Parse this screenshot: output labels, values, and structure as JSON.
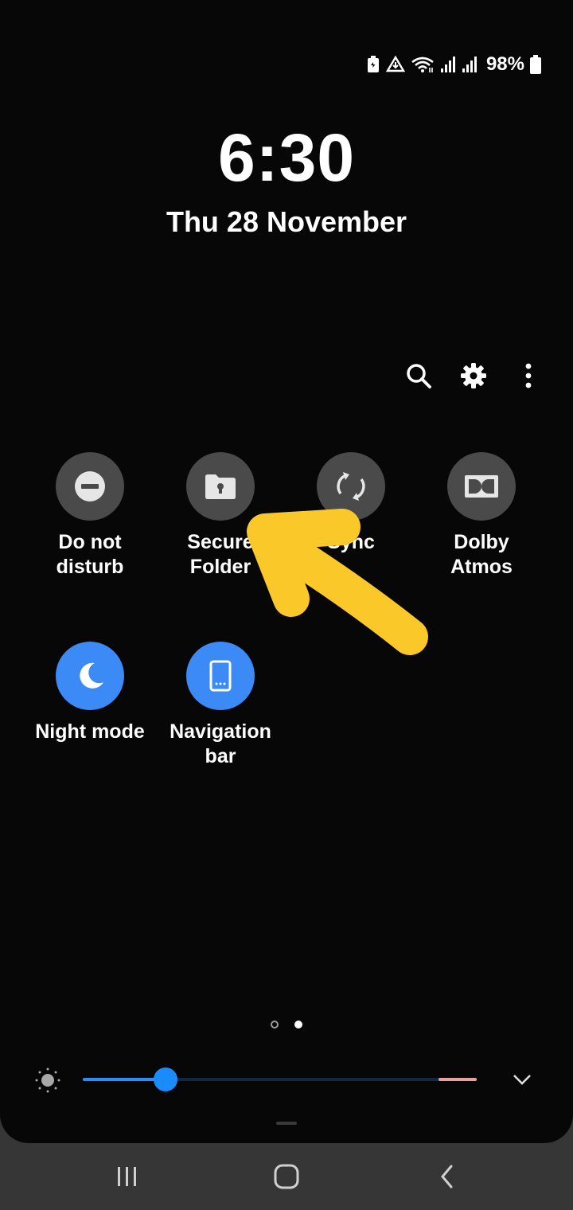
{
  "status_bar": {
    "battery_percent": "98%",
    "icons": [
      "battery-saver-icon",
      "data-saver-icon",
      "wifi-icon",
      "signal-icon",
      "signal-icon",
      "battery-icon"
    ]
  },
  "lock": {
    "time": "6:30",
    "date": "Thu 28 November"
  },
  "header_actions": [
    "search-icon",
    "gear-icon",
    "more-vert-icon"
  ],
  "tiles": [
    {
      "label": "Do not\ndisturb",
      "icon": "do-not-disturb-icon",
      "active": false
    },
    {
      "label": "Secure\nFolder",
      "icon": "secure-folder-icon",
      "active": false
    },
    {
      "label": "Sync",
      "icon": "sync-icon",
      "active": false
    },
    {
      "label": "Dolby\nAtmos",
      "icon": "dolby-icon",
      "active": false
    },
    {
      "label": "Night mode",
      "icon": "moon-icon",
      "active": true
    },
    {
      "label": "Navigation\nbar",
      "icon": "navigation-bar-icon",
      "active": true
    }
  ],
  "pager": {
    "pages": 2,
    "current_page": 2
  },
  "brightness": {
    "level": 0.21,
    "icon": "sun-icon",
    "expand_icon": "chevron-down-icon"
  },
  "navigation": [
    "recents-icon",
    "home-icon",
    "back-icon"
  ],
  "colors": {
    "accent": "#3c8af5",
    "tile_off": "#4a4a4a",
    "annotation": "#fbc82a"
  }
}
